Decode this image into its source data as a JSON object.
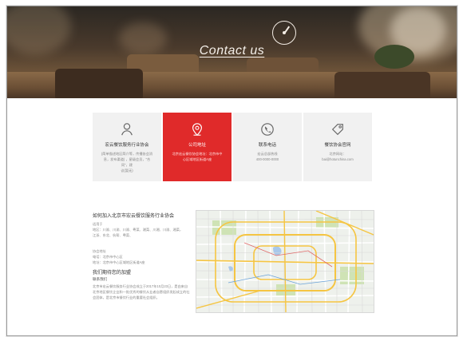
{
  "hero": {
    "title": "Contact us",
    "icon": "clock-icon"
  },
  "cards": [
    {
      "title": "宏云餐饮服务行业协会",
      "icon": "person-icon",
      "active": false,
      "lines": [
        "(简单描述地区简介等，传播协会消息，发布渠道) ，星级会员，“合同”，建",
        "议(暂无)"
      ]
    },
    {
      "title": "公司地址",
      "icon": "location-pin-icon",
      "active": true,
      "lines": [
        "北京宏云餐饮协会地址：北京市中",
        "心区域地区街道A座"
      ]
    },
    {
      "title": "联系电话",
      "icon": "phone-icon",
      "active": false,
      "lines": [
        "宏云总部热线",
        "400-0000-0000"
      ]
    },
    {
      "title": "餐饮协会官网",
      "icon": "tag-icon",
      "active": false,
      "lines": [
        "北京网站：",
        "bai@hotunchina.com"
      ]
    }
  ],
  "info": {
    "title": "如何加入北京市宏云餐饮服务行业协会",
    "sub1": "适用于",
    "sub1_lines": [
      "地区：川渝、川渝、川渝、粤菜、湘菜、川湘、川渝、湘菜，",
      "江浙、东北、杭帮、粤菜、"
    ],
    "contact_label": "协会地址",
    "contact_lines": [
      "电话：北京市中心区",
      "地址：北京市中心区域地区街道A座"
    ],
    "title2": "我们期待您的加盟",
    "sub2": "联系我们",
    "body_lines": [
      "北京市宏云餐饮服务行业协会成立于2017年10月23日，是由来自",
      "北京地区餐饮企业和一批优秀的餐饮从业者自愿组织发起成立的社",
      "会团体，是北京市餐饮行业的重要社会组织。"
    ]
  },
  "map": {
    "label": "北京市地图",
    "colors": {
      "ring": "#f5c542",
      "water": "#a9c8ea",
      "park": "#cfe3b5"
    }
  }
}
